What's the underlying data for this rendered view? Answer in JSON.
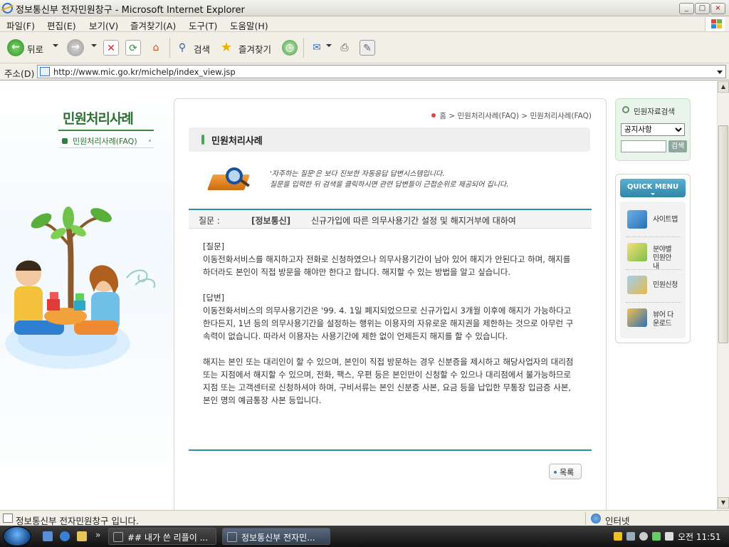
{
  "window": {
    "title": "정보통신부 전자민원창구 - Microsoft Internet Explorer",
    "min_label": "_",
    "max_label": "□",
    "close_label": "×"
  },
  "menu": [
    "파일(F)",
    "편집(E)",
    "보기(V)",
    "즐겨찾기(A)",
    "도구(T)",
    "도움말(H)"
  ],
  "toolbar": {
    "back_label": "뒤로",
    "search_label": "검색",
    "favorites_label": "즐겨찾기"
  },
  "address": {
    "label": "주소(D)",
    "url": "http://www.mic.go.kr/michelp/index_view.jsp"
  },
  "sidebar": {
    "title": "민원처리사례",
    "item": "민원처리사례(FAQ)"
  },
  "breadcrumb": {
    "home": "홈",
    "sep": ">",
    "level1": "민원처리사례(FAQ)",
    "level2": "민원처리사례(FAQ)"
  },
  "content": {
    "header": "민원처리사례",
    "intro_line1": "'자주하는 질문'은 보다 진보한 자동응답 답변시스템입니다.",
    "intro_line2": "질문을 입력한 뒤 검색을 클릭하시면 관련 답변들이 근접순위로 제공되어 집니다.",
    "question_label": "질문 :",
    "question_category": "[정보통신]",
    "question_title": "신규가입에 따른 의무사용기간 설정 및 해지거부에 대하여",
    "q_heading": "[질문]",
    "q_text": "이동전화서비스를 해지하고자 전화로 신청하였으나 의무사용기간이 남아 있어 해지가 안된다고 하며, 해지를 하더라도 본인이 직접 방문을 해야만 한다고 합니다. 해지할 수 있는 방법을 알고 싶습니다.",
    "a_heading": "[답변]",
    "a_text1": "이동전화서비스의 의무사용기간은 '99. 4. 1일 폐지되었으므로 신규가입시 3개월 이후에 해지가 가능하다고 한다든지, 1년 등의 의무사용기간을 설정하는 행위는 이용자의 자유로운 해지권을 제한하는 것으로 아무런 구속력이 없습니다. 따라서 이용자는 사용기간에 제한 없이 언제든지 해지를 할 수 있습니다.",
    "a_text2": "해지는 본인 또는 대리인이 할 수 있으며, 본인이 직접 방문하는 경우 신분증을 제시하고 해당사업자의 대리점 또는 지점에서 해지할 수 있으며, 전화, 팩스, 우편 등은 본인만이 신청할 수 있으나 대리점에서 불가능하므로 지점 또는 고객센터로 신청하셔야 하며, 구비서류는 본인 신분증 사본, 요금 등을 납입한 무통장 입금증 사본, 본인 명의 예금통장 사본 등입니다.",
    "list_button": "목록"
  },
  "search_panel": {
    "title": "민원자료검색",
    "select_value": "공지사항",
    "button": "검색"
  },
  "quick_menu": {
    "header": "QUICK MENU",
    "items": [
      {
        "label": "사이트맵",
        "icon": "folder-icon"
      },
      {
        "label": "분야별 민원안내",
        "icon": "notepad-icon"
      },
      {
        "label": "민원신청",
        "icon": "form-icon"
      },
      {
        "label": "뷰어 다운로드",
        "icon": "magnifier-icon"
      }
    ]
  },
  "status": {
    "text": "정보통신부 전자민원창구 입니다.",
    "zone": "인터넷"
  },
  "taskbar": {
    "chevron": "»",
    "task1": "## 내가 쓴 리플이 ...",
    "task2": "정보통신부 전자민...",
    "clock": "오전 11:51"
  }
}
